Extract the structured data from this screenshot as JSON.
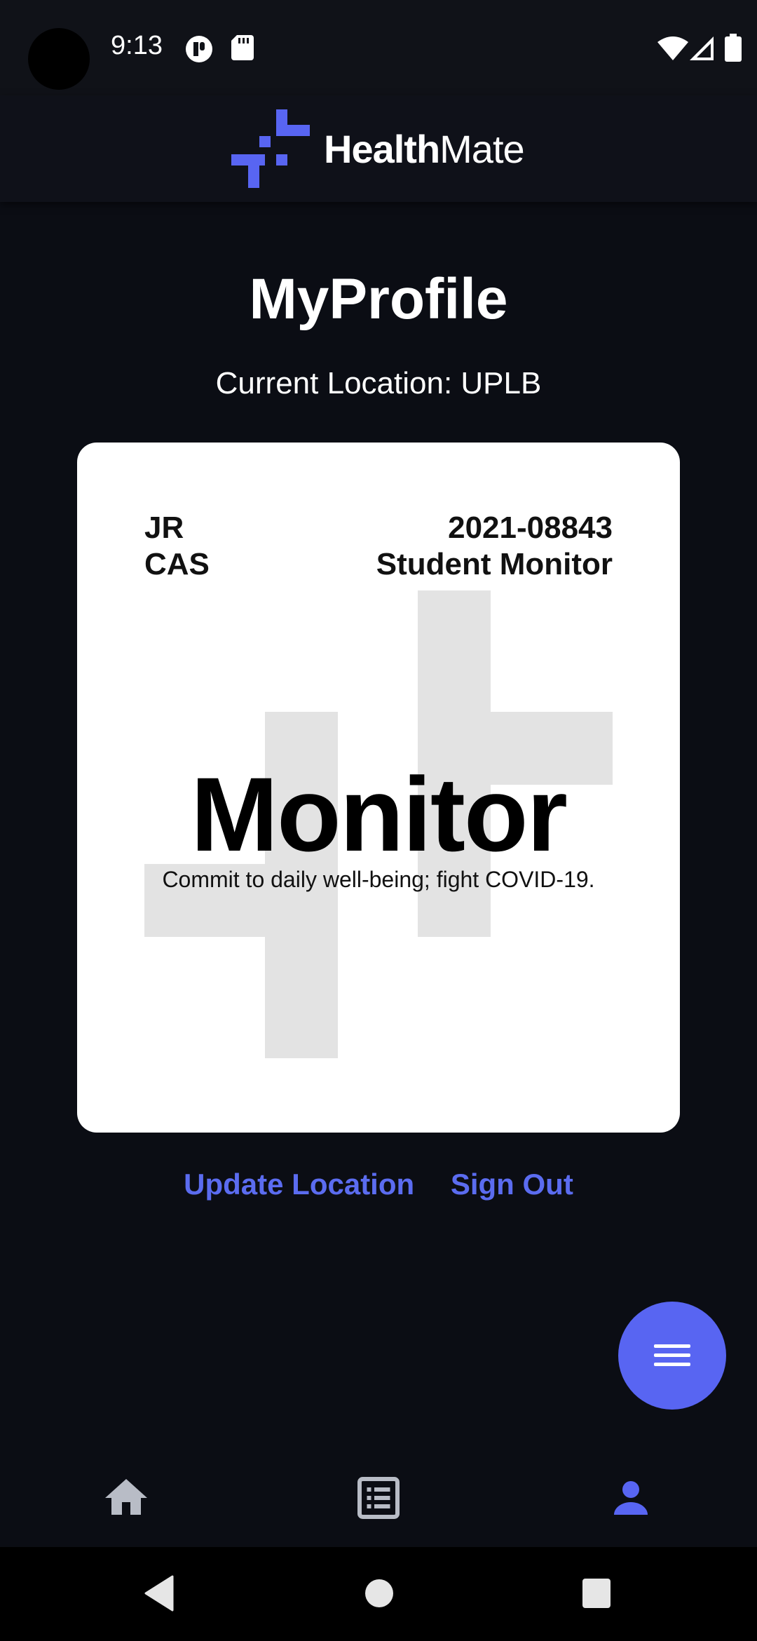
{
  "status_bar": {
    "time": "9:13",
    "icons": [
      "notification-app-icon",
      "sd-card-icon",
      "wifi-icon",
      "signal-icon",
      "battery-icon"
    ]
  },
  "header": {
    "brand_bold": "Health",
    "brand_light": "Mate",
    "logo_color": "#5865f2"
  },
  "page": {
    "title": "MyProfile",
    "location_label": "Current Location: UPLB"
  },
  "card": {
    "name": "JR",
    "college": "CAS",
    "student_number": "2021-08843",
    "designation": "Student Monitor",
    "role": "Monitor",
    "tagline": "Commit to daily well-being; fight COVID-19."
  },
  "actions": {
    "update_location": "Update Location",
    "sign_out": "Sign Out",
    "link_color": "#5b6cf0"
  },
  "fab": {
    "icon": "menu-icon",
    "color": "#5865f2"
  },
  "bottom_nav": {
    "items": [
      {
        "icon": "home-icon",
        "active": false
      },
      {
        "icon": "list-icon",
        "active": false
      },
      {
        "icon": "person-icon",
        "active": true
      }
    ],
    "active_color": "#5865f2",
    "inactive_color": "#b8bcc6"
  },
  "system_nav": {
    "buttons": [
      "back-icon",
      "home-circle-icon",
      "recents-icon"
    ]
  }
}
